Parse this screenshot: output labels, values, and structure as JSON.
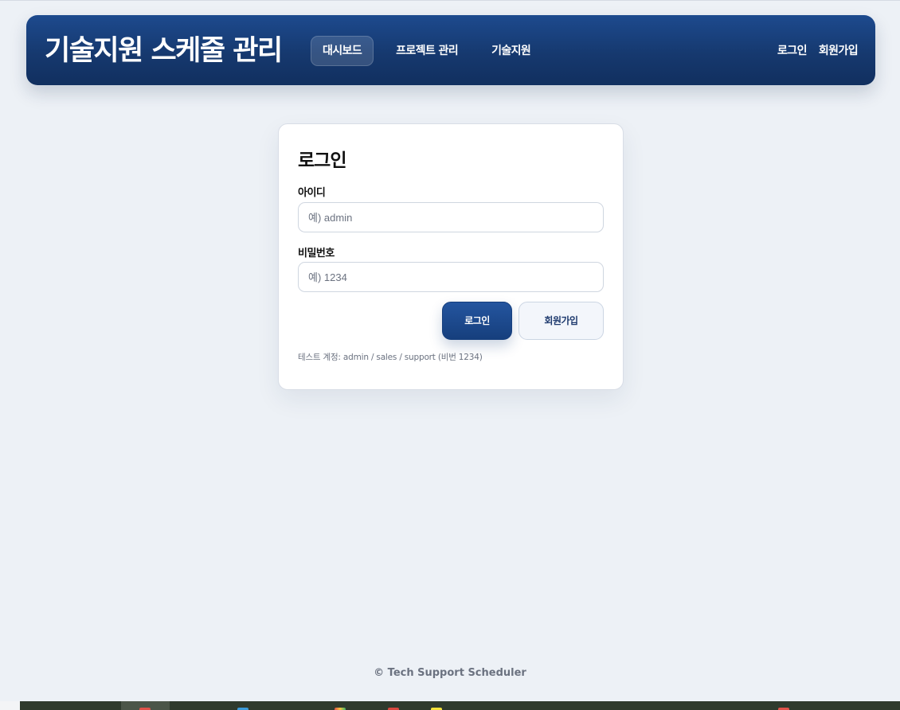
{
  "header": {
    "brand": "기술지원 스케줄 관리",
    "nav": [
      {
        "label": "대시보드",
        "active": true
      },
      {
        "label": "프로젝트 관리",
        "active": false
      },
      {
        "label": "기술지원",
        "active": false
      }
    ],
    "auth": {
      "login_label": "로그인",
      "signup_label": "회원가입"
    }
  },
  "login_card": {
    "title": "로그인",
    "id_label": "아이디",
    "id_value": "",
    "id_placeholder": "예) admin",
    "password_label": "비밀번호",
    "password_value": "",
    "password_placeholder": "예) 1234",
    "login_button": "로그인",
    "signup_button": "회원가입",
    "hint": "테스트 계정: admin / sales / support (비번 1234)"
  },
  "footer": {
    "text": "© Tech Support Scheduler"
  },
  "colors": {
    "primary": "#1d4a8e",
    "primary_dark": "#112f5f",
    "background": "#edf1f6",
    "muted_text": "#6b7280"
  },
  "icons": {
    "taskbar": [
      "app-icon-red",
      "app-icon-blue",
      "app-icon-multicolor",
      "app-icon-red-2",
      "app-icon-yellow",
      "app-icon-red-3"
    ]
  }
}
